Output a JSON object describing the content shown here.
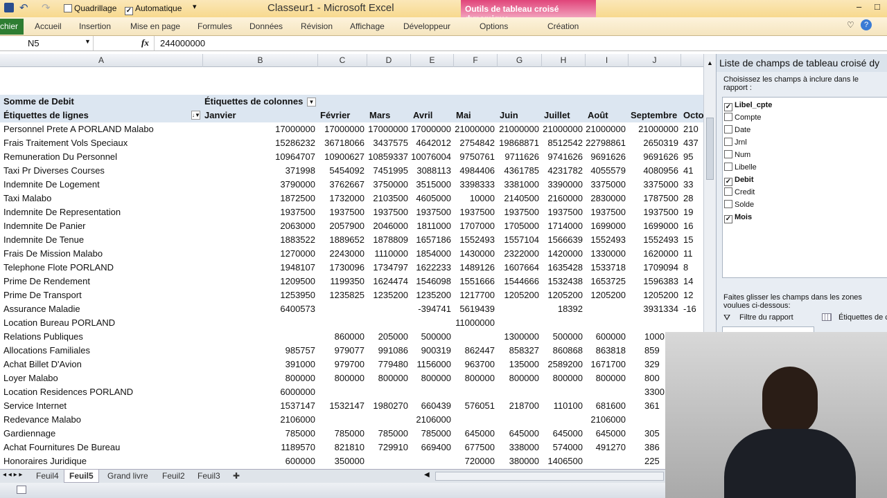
{
  "window": {
    "title": "Classeur1 - Microsoft Excel",
    "contextual_tab_group": "Outils de tableau croisé dynamique"
  },
  "qat": {
    "gridlines_label": "Quadrillage",
    "auto_label": "Automatique",
    "gridlines_checked": false,
    "auto_checked": true
  },
  "ribbon": {
    "file": "chier",
    "tabs": [
      "Accueil",
      "Insertion",
      "Mise en page",
      "Formules",
      "Données",
      "Révision",
      "Affichage",
      "Développeur",
      "Options",
      "Création"
    ]
  },
  "formula_bar": {
    "name_box": "N5",
    "fx": "fx",
    "value": "244000000"
  },
  "columns": [
    "A",
    "B",
    "C",
    "D",
    "E",
    "F",
    "G",
    "H",
    "I",
    "J"
  ],
  "pivot": {
    "value_label": "Somme de Debit",
    "column_labels": "Étiquettes de colonnes",
    "row_labels": "Étiquettes de lignes",
    "months": [
      "Janvier",
      "Février",
      "Mars",
      "Avril",
      "Mai",
      "Juin",
      "Juillet",
      "Août",
      "Septembre",
      "Octo"
    ],
    "rows": [
      {
        "name": "Personnel Prete A PORLAND Malabo",
        "values": [
          "17000000",
          "17000000",
          "17000000",
          "17000000",
          "21000000",
          "21000000",
          "21000000",
          "21000000",
          "21000000",
          "210"
        ]
      },
      {
        "name": "Frais Traitement Vols Speciaux",
        "values": [
          "15286232",
          "36718066",
          "3437575",
          "4642012",
          "2754842",
          "19868871",
          "8512542",
          "22798861",
          "2650319",
          "437"
        ]
      },
      {
        "name": "Remuneration Du Personnel",
        "values": [
          "10964707",
          "10900627",
          "10859337",
          "10076004",
          "9750761",
          "9711626",
          "9741626",
          "9691626",
          "9691626",
          "95"
        ]
      },
      {
        "name": "Taxi Pr Diverses Courses",
        "values": [
          "371998",
          "5454092",
          "7451995",
          "3088113",
          "4984406",
          "4361785",
          "4231782",
          "4055579",
          "4080956",
          "41"
        ]
      },
      {
        "name": "Indemnite De Logement",
        "values": [
          "3790000",
          "3762667",
          "3750000",
          "3515000",
          "3398333",
          "3381000",
          "3390000",
          "3375000",
          "3375000",
          "33"
        ]
      },
      {
        "name": "Taxi Malabo",
        "values": [
          "1872500",
          "1732000",
          "2103500",
          "4605000",
          "10000",
          "2140500",
          "2160000",
          "2830000",
          "1787500",
          "28"
        ]
      },
      {
        "name": "Indemnite De Representation",
        "values": [
          "1937500",
          "1937500",
          "1937500",
          "1937500",
          "1937500",
          "1937500",
          "1937500",
          "1937500",
          "1937500",
          "19"
        ]
      },
      {
        "name": "Indemnite De Panier",
        "values": [
          "2063000",
          "2057900",
          "2046000",
          "1811000",
          "1707000",
          "1705000",
          "1714000",
          "1699000",
          "1699000",
          "16"
        ]
      },
      {
        "name": "Indemnite De Tenue",
        "values": [
          "1883522",
          "1889652",
          "1878809",
          "1657186",
          "1552493",
          "1557104",
          "1566639",
          "1552493",
          "1552493",
          "15"
        ]
      },
      {
        "name": "Frais De Mission Malabo",
        "values": [
          "1270000",
          "2243000",
          "1110000",
          "1854000",
          "1430000",
          "2322000",
          "1420000",
          "1330000",
          "1620000",
          "11"
        ]
      },
      {
        "name": "Telephone Flote PORLAND",
        "values": [
          "1948107",
          "1730096",
          "1734797",
          "1622233",
          "1489126",
          "1607664",
          "1635428",
          "1533718",
          "1709094",
          "8"
        ]
      },
      {
        "name": "Prime De Rendement",
        "values": [
          "1209500",
          "1199350",
          "1624474",
          "1546098",
          "1551666",
          "1544666",
          "1532438",
          "1653725",
          "1596383",
          "14"
        ]
      },
      {
        "name": "Prime De Transport",
        "values": [
          "1253950",
          "1235825",
          "1235200",
          "1235200",
          "1217700",
          "1205200",
          "1205200",
          "1205200",
          "1205200",
          "12"
        ]
      },
      {
        "name": "Assurance Maladie",
        "values": [
          "6400573",
          "",
          "",
          "-394741",
          "5619439",
          "",
          "18392",
          "",
          "3931334",
          "-16"
        ]
      },
      {
        "name": "Location Bureau PORLAND",
        "values": [
          "",
          "",
          "",
          "",
          "11000000",
          "",
          "",
          "",
          "",
          ""
        ]
      },
      {
        "name": "Relations Publiques",
        "values": [
          "",
          "860000",
          "205000",
          "500000",
          "",
          "1300000",
          "500000",
          "600000",
          "1000",
          ""
        ]
      },
      {
        "name": "Allocations Familiales",
        "values": [
          "985757",
          "979077",
          "991086",
          "900319",
          "862447",
          "858327",
          "860868",
          "863818",
          "859",
          ""
        ]
      },
      {
        "name": "Achat Billet D'Avion",
        "values": [
          "391000",
          "979700",
          "779480",
          "1156000",
          "963700",
          "135000",
          "2589200",
          "1671700",
          "329",
          ""
        ]
      },
      {
        "name": "Loyer Malabo",
        "values": [
          "800000",
          "800000",
          "800000",
          "800000",
          "800000",
          "800000",
          "800000",
          "800000",
          "800",
          ""
        ]
      },
      {
        "name": "Location Residences PORLAND",
        "values": [
          "6000000",
          "",
          "",
          "",
          "",
          "",
          "",
          "",
          "3300",
          ""
        ]
      },
      {
        "name": "Service Internet",
        "values": [
          "1537147",
          "1532147",
          "1980270",
          "660439",
          "576051",
          "218700",
          "110100",
          "681600",
          "361",
          ""
        ]
      },
      {
        "name": "Redevance Malabo",
        "values": [
          "2106000",
          "",
          "",
          "2106000",
          "",
          "",
          "",
          "2106000",
          "",
          ""
        ]
      },
      {
        "name": "Gardiennage",
        "values": [
          "785000",
          "785000",
          "785000",
          "785000",
          "645000",
          "645000",
          "645000",
          "645000",
          "305",
          ""
        ]
      },
      {
        "name": "Achat Fournitures De Bureau",
        "values": [
          "1189570",
          "821810",
          "729910",
          "669400",
          "677500",
          "338000",
          "574000",
          "491270",
          "386",
          ""
        ]
      },
      {
        "name": "Honoraires Juridique",
        "values": [
          "600000",
          "350000",
          "",
          "",
          "720000",
          "380000",
          "1406500",
          "",
          "225",
          ""
        ]
      }
    ]
  },
  "field_list": {
    "title": "Liste de champs de tableau croisé dy",
    "instruction": "Choisissez les champs à inclure dans le rapport :",
    "fields": [
      {
        "name": "Libel_cpte",
        "checked": true
      },
      {
        "name": "Compte",
        "checked": false
      },
      {
        "name": "Date",
        "checked": false
      },
      {
        "name": "Jrnl",
        "checked": false
      },
      {
        "name": "Num",
        "checked": false
      },
      {
        "name": "Libelle",
        "checked": false
      },
      {
        "name": "Debit",
        "checked": true
      },
      {
        "name": "Credit",
        "checked": false
      },
      {
        "name": "Solde",
        "checked": false
      },
      {
        "name": "Mois",
        "checked": true
      }
    ],
    "drag_hint": "Faites glisser les champs dans les zones voulues ci-dessous:",
    "report_filter": "Filtre du rapport",
    "column_labels": "Étiquettes de c"
  },
  "sheets": [
    "Feuil4",
    "Feuil5",
    "Grand livre",
    "Feuil2",
    "Feuil3"
  ],
  "active_sheet": "Feuil5"
}
